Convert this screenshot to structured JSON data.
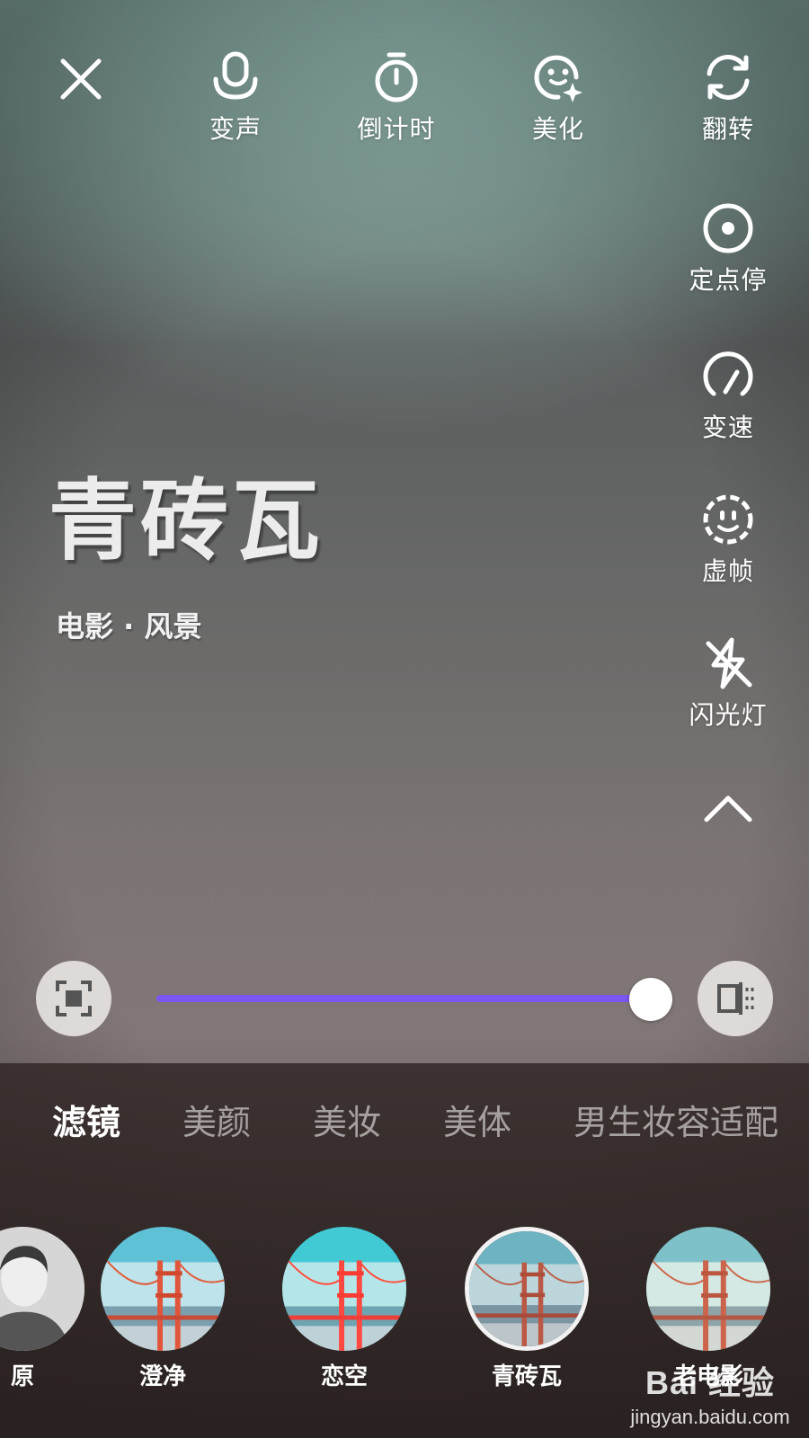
{
  "top_bar": {
    "items": [
      {
        "id": "voice",
        "label": "变声",
        "icon": "microphone-icon"
      },
      {
        "id": "countdown",
        "label": "倒计时",
        "icon": "timer-icon"
      },
      {
        "id": "beautify",
        "label": "美化",
        "icon": "sparkle-face-icon"
      },
      {
        "id": "flip",
        "label": "翻转",
        "icon": "flip-camera-icon"
      }
    ]
  },
  "side_bar": {
    "items": [
      {
        "id": "point_stop",
        "label": "定点停",
        "icon": "target-icon"
      },
      {
        "id": "speed",
        "label": "变速",
        "icon": "speedometer-icon"
      },
      {
        "id": "blur_frame",
        "label": "虚帧",
        "icon": "dotted-face-icon"
      },
      {
        "id": "flash",
        "label": "闪光灯",
        "icon": "flash-off-icon"
      }
    ]
  },
  "filter": {
    "title": "青砖瓦",
    "subtitle": "电影 · 风景"
  },
  "slider": {
    "value_fraction": 1.0,
    "fill_color": "#7b56f0"
  },
  "tabs": [
    "滤镜",
    "美颜",
    "美妆",
    "美体",
    "男生妆容适配"
  ],
  "active_tab": "滤镜",
  "filters": [
    {
      "name": "原",
      "style": "portrait"
    },
    {
      "name": "澄净",
      "style": "bridge"
    },
    {
      "name": "恋空",
      "style": "bridge"
    },
    {
      "name": "青砖瓦",
      "style": "bridge",
      "selected": true
    },
    {
      "name": "老电影",
      "style": "bridge"
    }
  ],
  "watermark": {
    "logo": "Bai 经验",
    "url": "jingyan.baidu.com"
  }
}
